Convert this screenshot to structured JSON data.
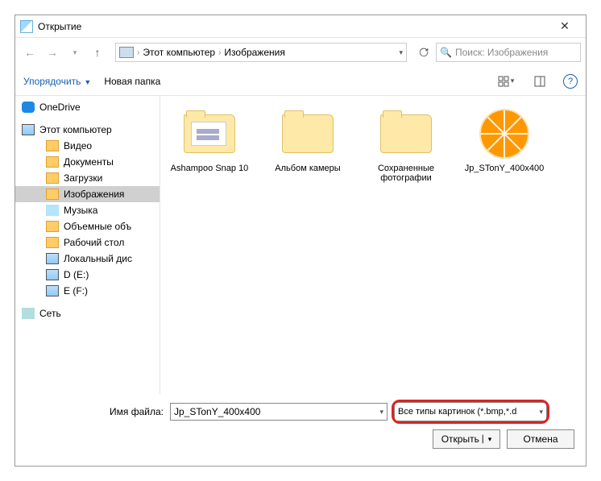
{
  "window": {
    "title": "Открытие"
  },
  "nav": {
    "crumb1": "Этот компьютер",
    "crumb2": "Изображения",
    "search_placeholder": "Поиск: Изображения"
  },
  "toolbar": {
    "organize": "Упорядочить",
    "new_folder": "Новая папка"
  },
  "tree": {
    "onedrive": "OneDrive",
    "this_pc": "Этот компьютер",
    "videos": "Видео",
    "documents": "Документы",
    "downloads": "Загрузки",
    "pictures": "Изображения",
    "music": "Музыка",
    "volumes": "Объемные объ",
    "desktop": "Рабочий стол",
    "local_disk": "Локальный дис",
    "d_drive": "D (E:)",
    "e_drive": "E (F:)",
    "network": "Сеть"
  },
  "files": {
    "f1": "Ashampoo Snap 10",
    "f2": "Альбом камеры",
    "f3": "Сохраненные фотографии",
    "f4": "Jp_STonY_400x400"
  },
  "bottom": {
    "filename_label": "Имя файла:",
    "filename_value": "Jp_STonY_400x400",
    "filter_text": "Все типы картинок (*.bmp,*.d",
    "open": "Открыть",
    "cancel": "Отмена"
  }
}
